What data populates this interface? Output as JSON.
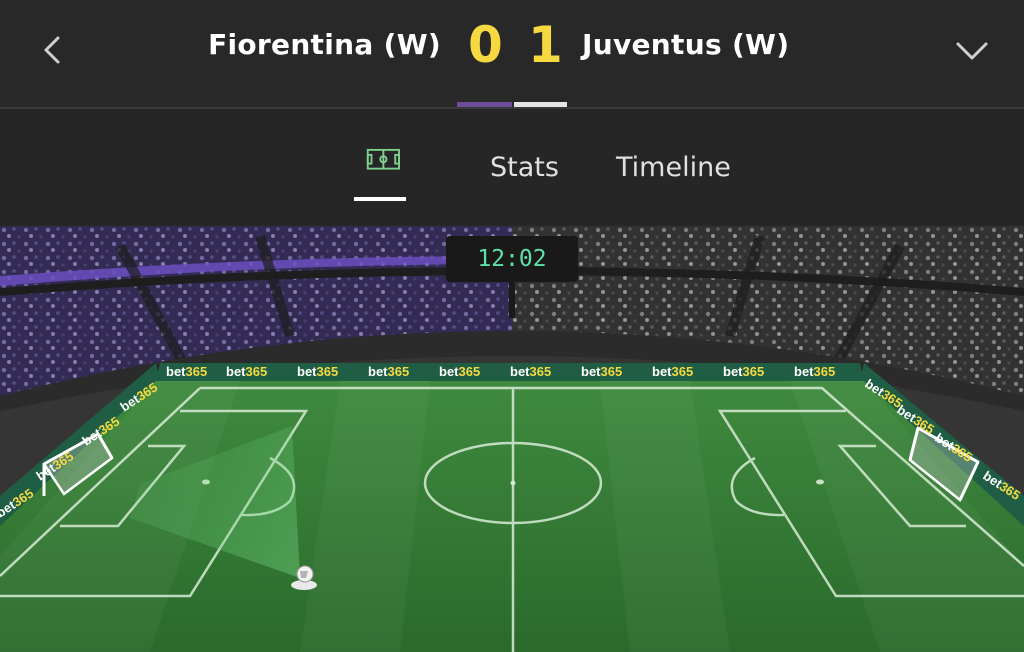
{
  "header": {
    "home_team": "Fiorentina (W)",
    "away_team": "Juventus (W)",
    "home_score": "0",
    "away_score": "1",
    "home_color": "#6d4c9a",
    "away_color": "#e6e6e6",
    "score_color": "#f6d941",
    "back_icon": "chevron-left-icon",
    "expand_icon": "chevron-down-icon"
  },
  "tabs": {
    "pitch_icon": "pitch-icon",
    "stats_label": "Stats",
    "timeline_label": "Timeline",
    "active": "pitch"
  },
  "match": {
    "clock": "12:02",
    "ad_text": "bet365"
  }
}
